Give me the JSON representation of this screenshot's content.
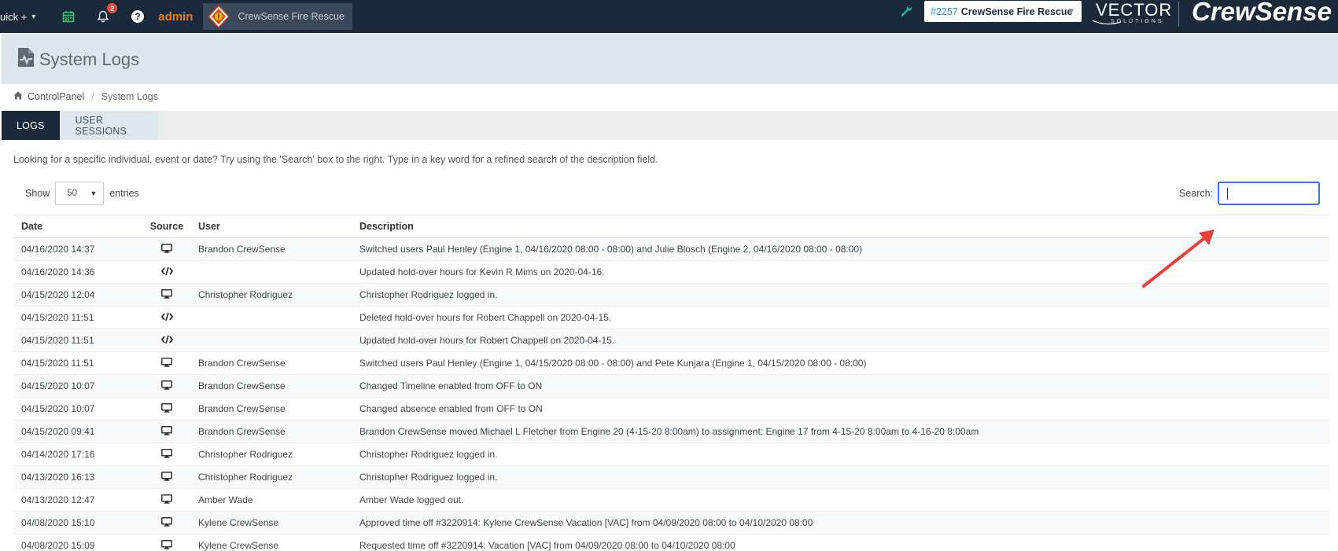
{
  "topbar": {
    "quick_label": "uick +",
    "notification_count": "2",
    "admin_label": "admin",
    "org_name": "CrewSense Fire Rescue",
    "org_select_number": "#2257",
    "org_select_name": "CrewSense Fire Rescue",
    "vector_logo_main": "VECTOR",
    "vector_logo_sub": "SOLUTIONS",
    "brand": "CrewSense"
  },
  "page": {
    "title": "System Logs"
  },
  "breadcrumb": {
    "home": "ControlPanel",
    "current": "System Logs"
  },
  "tabs": [
    {
      "label": "LOGS",
      "active": true
    },
    {
      "label": "USER SESSIONS",
      "active": false
    }
  ],
  "help_text": "Looking for a specific individual, event or date? Try using the 'Search' box to the right. Type in a key word for a refined search of the description field.",
  "controls": {
    "show_label": "Show",
    "entries_value": "50",
    "entries_label": "entries",
    "search_label": "Search:",
    "search_value": ""
  },
  "table": {
    "headers": [
      "Date",
      "Source",
      "User",
      "Description"
    ],
    "rows": [
      {
        "date": "04/16/2020 14:37",
        "source": "monitor-icon",
        "user": "Brandon CrewSense",
        "description": "Switched users Paul Henley (Engine 1, 04/16/2020 08:00 - 08:00) and Julie Blosch (Engine 2, 04/16/2020 08:00 - 08:00)"
      },
      {
        "date": "04/16/2020 14:36",
        "source": "code-icon",
        "user": "",
        "description": "Updated hold-over hours for Kevin R Mims on 2020-04-16."
      },
      {
        "date": "04/15/2020 12:04",
        "source": "monitor-icon",
        "user": "Christopher Rodriguez",
        "description": "Christopher Rodriguez logged in."
      },
      {
        "date": "04/15/2020 11:51",
        "source": "code-icon",
        "user": "",
        "description": "Deleted hold-over hours for Robert Chappell on 2020-04-15."
      },
      {
        "date": "04/15/2020 11:51",
        "source": "code-icon",
        "user": "",
        "description": "Updated hold-over hours for Robert Chappell on 2020-04-15."
      },
      {
        "date": "04/15/2020 11:51",
        "source": "monitor-icon",
        "user": "Brandon CrewSense",
        "description": "Switched users Paul Henley (Engine 1, 04/15/2020 08:00 - 08:00) and Pete Kunjara (Engine 1, 04/15/2020 08:00 - 08:00)"
      },
      {
        "date": "04/15/2020 10:07",
        "source": "monitor-icon",
        "user": "Brandon CrewSense",
        "description": "Changed Timeline enabled from OFF to ON"
      },
      {
        "date": "04/15/2020 10:07",
        "source": "monitor-icon",
        "user": "Brandon CrewSense",
        "description": "Changed absence enabled from OFF to ON"
      },
      {
        "date": "04/15/2020 09:41",
        "source": "monitor-icon",
        "user": "Brandon CrewSense",
        "description": "Brandon CrewSense moved Michael L Fletcher from Engine 20 (4-15-20 8:00am) to assignment: Engine 17 from 4-15-20 8:00am to 4-16-20 8:00am"
      },
      {
        "date": "04/14/2020 17:16",
        "source": "monitor-icon",
        "user": "Christopher Rodriguez",
        "description": "Christopher Rodriguez logged in."
      },
      {
        "date": "04/13/2020 16:13",
        "source": "monitor-icon",
        "user": "Christopher Rodriguez",
        "description": "Christopher Rodriguez logged in."
      },
      {
        "date": "04/13/2020 12:47",
        "source": "monitor-icon",
        "user": "Amber Wade",
        "description": "Amber Wade logged out."
      },
      {
        "date": "04/08/2020 15:10",
        "source": "monitor-icon",
        "user": "Kylene CrewSense",
        "description": "Approved time off #3220914: Kylene CrewSense Vacation [VAC] from 04/09/2020 08:00 to 04/10/2020 08:00"
      },
      {
        "date": "04/08/2020 15:09",
        "source": "monitor-icon",
        "user": "Kylene CrewSense",
        "description": "Requested time off #3220914: Vacation [VAC] from 04/09/2020 08:00 to 04/10/2020 08:00"
      }
    ]
  },
  "colors": {
    "nav_bg": "#1b2a3a",
    "admin_orange": "#e67e22",
    "wrench_teal": "#1abc9c",
    "calendar_green": "#2ecc71",
    "badge_red": "#e74c3c",
    "annotation_arrow": "#e8413c",
    "search_focus": "#3b74d8"
  }
}
